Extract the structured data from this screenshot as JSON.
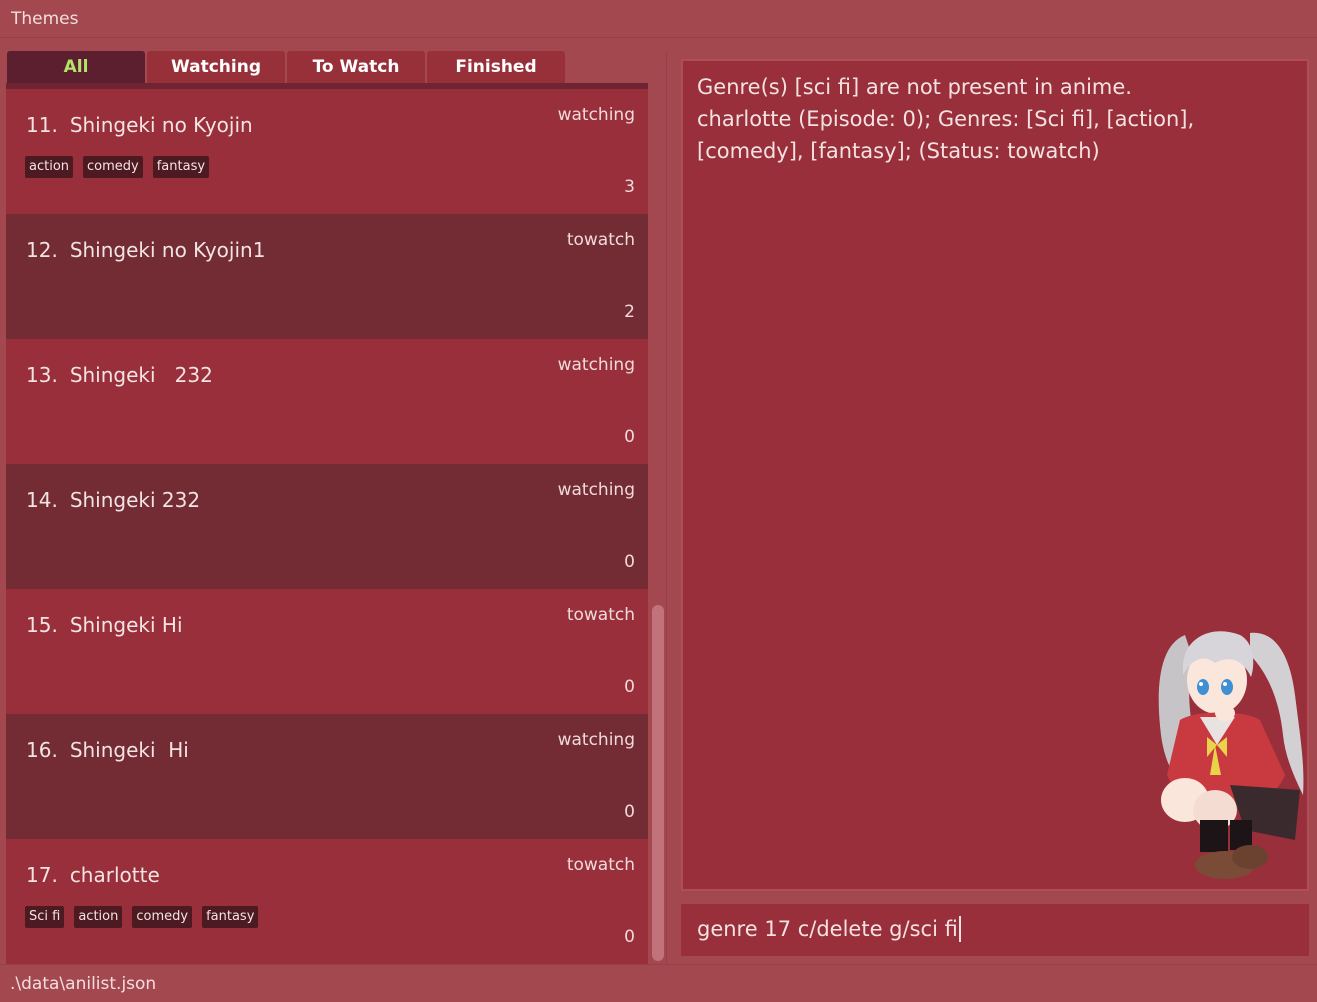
{
  "menu": {
    "themes_label": "Themes"
  },
  "tabs": [
    {
      "label": "All",
      "active": true
    },
    {
      "label": "Watching",
      "active": false
    },
    {
      "label": "To Watch",
      "active": false
    },
    {
      "label": "Finished",
      "active": false
    }
  ],
  "anime_list": [
    {
      "index": "11.",
      "title": "Shingeki no Kyojin",
      "status": "watching",
      "episode": "3",
      "genres": [
        "action",
        "comedy",
        "fantasy"
      ]
    },
    {
      "index": "12.",
      "title": "Shingeki no Kyojin1",
      "status": "towatch",
      "episode": "2",
      "genres": []
    },
    {
      "index": "13.",
      "title": "Shingeki   232",
      "status": "watching",
      "episode": "0",
      "genres": []
    },
    {
      "index": "14.",
      "title": "Shingeki 232",
      "status": "watching",
      "episode": "0",
      "genres": []
    },
    {
      "index": "15.",
      "title": "Shingeki Hi",
      "status": "towatch",
      "episode": "0",
      "genres": []
    },
    {
      "index": "16.",
      "title": "Shingeki  Hi",
      "status": "watching",
      "episode": "0",
      "genres": []
    },
    {
      "index": "17.",
      "title": "charlotte",
      "status": "towatch",
      "episode": "0",
      "genres": [
        "Sci fi",
        "action",
        "comedy",
        "fantasy"
      ]
    }
  ],
  "result": {
    "line1": "Genre(s) [sci fi] are not present in anime.",
    "line2": "charlotte (Episode: 0); Genres: [Sci fi], [action], [comedy], [fantasy]; (Status: towatch)"
  },
  "command": {
    "value": "genre 17 c/delete g/sci fi"
  },
  "status_bar": {
    "path": ".\\data\\anilist.json"
  },
  "colors": {
    "background": "#a44850",
    "card_light": "#982f3b",
    "card_dark": "#732b34",
    "tab_active_bg": "#5c1f2f",
    "tab_active_text": "#b4e36a",
    "tag_bg": "#4d1a22"
  }
}
